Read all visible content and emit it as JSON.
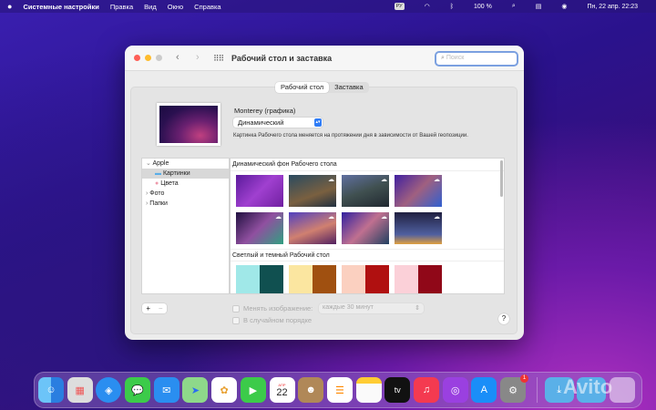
{
  "menubar": {
    "app": "Системные настройки",
    "items": [
      "Правка",
      "Вид",
      "Окно",
      "Справка"
    ],
    "input_source": "РУ",
    "battery": "100 %",
    "datetime": "Пн, 22 апр.  22:23"
  },
  "window": {
    "title": "Рабочий стол и заставка",
    "search_placeholder": "Поиск",
    "tabs": [
      "Рабочий стол",
      "Заставка"
    ],
    "wallpaper_name": "Monterey (графика)",
    "mode": "Динамический",
    "description": "Картинка Рабочего стола меняется на протяжении дня в зависимости от Вашей геопозиции.",
    "sidebar": {
      "group": "Apple",
      "items": [
        "Картинки",
        "Цвета"
      ],
      "other": [
        "Фото",
        "Папки"
      ]
    },
    "sections": [
      "Динамический фон Рабочего стола",
      "Светлый и темный Рабочий стол"
    ],
    "change_label": "Менять изображение:",
    "interval": "каждые 30 минут",
    "random_label": "В случайном порядке",
    "add": "+",
    "remove": "−",
    "help": "?"
  },
  "dock": {
    "calendar_month": "АПР",
    "calendar_day": "22",
    "tv": "tv",
    "settings_badge": "1"
  },
  "watermark": "Avito",
  "colors": {
    "accent": "#2f7cf6"
  }
}
